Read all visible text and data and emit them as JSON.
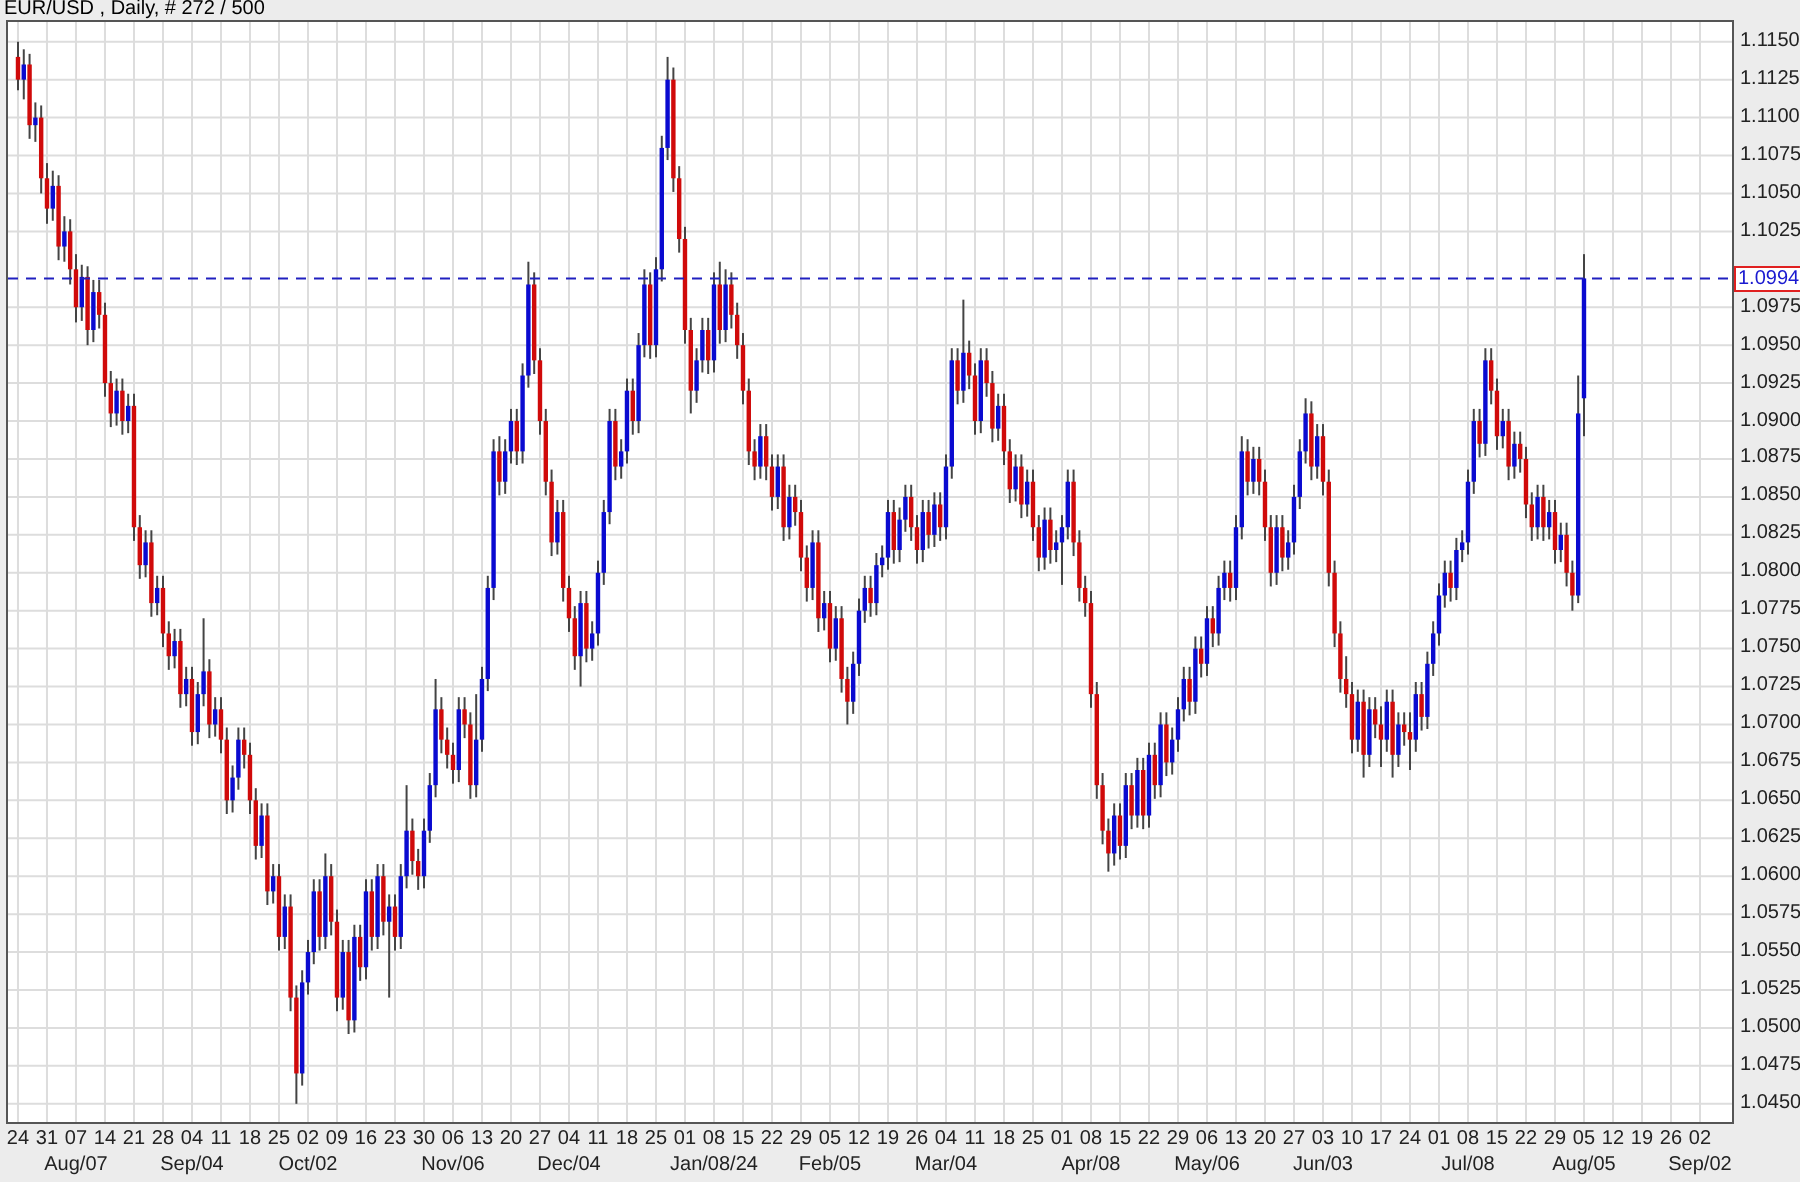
{
  "header": {
    "title": "EUR/USD , Daily, # 272 / 500"
  },
  "chart": {
    "periods": [
      "Aug/07",
      "Sep/04",
      "Oct/02",
      "Nov/06",
      "Dec/04",
      "Jan/08/24",
      "Feb/05",
      "Mar/04",
      "Apr/08",
      "May/06",
      "Jun/03",
      "Jul/08",
      "Aug/05",
      "Sep/02"
    ],
    "chart_data": {
      "type": "candlestick",
      "ylim": [
        1.0438,
        1.1163
      ],
      "grid": true,
      "ref_lines": [
        {
          "axis": "y",
          "value": 1.0994,
          "label": "1.0994"
        }
      ],
      "categories": [
        "24",
        null,
        null,
        null,
        null,
        "31",
        null,
        null,
        null,
        null,
        "07",
        null,
        null,
        null,
        null,
        "14",
        null,
        null,
        null,
        null,
        "21",
        null,
        null,
        null,
        null,
        "28",
        null,
        null,
        null,
        null,
        "04",
        null,
        null,
        null,
        null,
        "11",
        null,
        null,
        null,
        null,
        "18",
        null,
        null,
        null,
        null,
        "25",
        null,
        null,
        null,
        null,
        "02",
        null,
        null,
        null,
        null,
        "09",
        null,
        null,
        null,
        null,
        "16",
        null,
        null,
        null,
        null,
        "23",
        null,
        null,
        null,
        null,
        "30",
        null,
        null,
        null,
        null,
        "06",
        null,
        null,
        null,
        null,
        "13",
        null,
        null,
        null,
        null,
        "20",
        null,
        null,
        null,
        null,
        "27",
        null,
        null,
        null,
        null,
        "04",
        null,
        null,
        null,
        null,
        "11",
        null,
        null,
        null,
        null,
        "18",
        null,
        null,
        null,
        null,
        "25",
        null,
        null,
        null,
        null,
        "01",
        null,
        null,
        null,
        null,
        "08",
        null,
        null,
        null,
        null,
        "15",
        null,
        null,
        null,
        null,
        "22",
        null,
        null,
        null,
        null,
        "29",
        null,
        null,
        null,
        null,
        "05",
        null,
        null,
        null,
        null,
        "12",
        null,
        null,
        null,
        null,
        "19",
        null,
        null,
        null,
        null,
        "26",
        null,
        null,
        null,
        null,
        "04",
        null,
        null,
        null,
        null,
        "11",
        null,
        null,
        null,
        null,
        "18",
        null,
        null,
        null,
        null,
        "25",
        null,
        null,
        null,
        null,
        "01",
        null,
        null,
        null,
        null,
        "08",
        null,
        null,
        null,
        null,
        "15",
        null,
        null,
        null,
        null,
        "22",
        null,
        null,
        null,
        null,
        "29",
        null,
        null,
        null,
        null,
        "06",
        null,
        null,
        null,
        null,
        "13",
        null,
        null,
        null,
        null,
        "20",
        null,
        null,
        null,
        null,
        "27",
        null,
        null,
        null,
        null,
        "03",
        null,
        null,
        null,
        null,
        "10",
        null,
        null,
        null,
        null,
        "17",
        null,
        null,
        null,
        null,
        "24",
        null,
        null,
        null,
        null,
        "01",
        null,
        null,
        null,
        null,
        "08",
        null,
        null,
        null,
        null,
        "15",
        null,
        null,
        null,
        null,
        "22",
        null,
        null,
        null,
        null,
        "29",
        null,
        null,
        null,
        null,
        "05",
        null,
        null,
        null,
        null,
        "12",
        null,
        null,
        null,
        null,
        "19",
        null,
        null,
        null,
        null,
        "26",
        null,
        null,
        null,
        null,
        "02"
      ],
      "yticks": [
        {
          "value": 1.115,
          "label": "1.1150"
        },
        {
          "value": 1.1125,
          "label": "1.1125"
        },
        {
          "value": 1.11,
          "label": "1.1100"
        },
        {
          "value": 1.1075,
          "label": "1.1075"
        },
        {
          "value": 1.105,
          "label": "1.1050"
        },
        {
          "value": 1.1025,
          "label": "1.1025"
        },
        {
          "value": 1.0975,
          "label": "1.0975"
        },
        {
          "value": 1.095,
          "label": "1.0950"
        },
        {
          "value": 1.0925,
          "label": "1.0925"
        },
        {
          "value": 1.09,
          "label": "1.0900"
        },
        {
          "value": 1.0875,
          "label": "1.0875"
        },
        {
          "value": 1.085,
          "label": "1.0850"
        },
        {
          "value": 1.0825,
          "label": "1.0825"
        },
        {
          "value": 1.08,
          "label": "1.0800"
        },
        {
          "value": 1.0775,
          "label": "1.0775"
        },
        {
          "value": 1.075,
          "label": "1.0750"
        },
        {
          "value": 1.0725,
          "label": "1.0725"
        },
        {
          "value": 1.07,
          "label": "1.0700"
        },
        {
          "value": 1.0675,
          "label": "1.0675"
        },
        {
          "value": 1.065,
          "label": "1.0650"
        },
        {
          "value": 1.0625,
          "label": "1.0625"
        },
        {
          "value": 1.06,
          "label": "1.0600"
        },
        {
          "value": 1.0575,
          "label": "1.0575"
        },
        {
          "value": 1.055,
          "label": "1.0550"
        },
        {
          "value": 1.0525,
          "label": "1.0525"
        },
        {
          "value": 1.05,
          "label": "1.0500"
        },
        {
          "value": 1.0475,
          "label": "1.0475"
        },
        {
          "value": 1.045,
          "label": "1.0450"
        }
      ],
      "ohlc": [
        [
          1.114,
          1.115,
          1.1118,
          1.1125
        ],
        [
          1.1125,
          1.1145,
          1.1112,
          1.1135
        ],
        [
          1.1135,
          1.1142,
          1.1086,
          1.1095
        ],
        [
          1.1095,
          1.111,
          1.1084,
          1.11
        ],
        [
          1.11,
          1.1108,
          1.105,
          1.106
        ],
        [
          1.106,
          1.107,
          1.103,
          1.104
        ],
        [
          1.104,
          1.1065,
          1.1032,
          1.1055
        ],
        [
          1.1055,
          1.1062,
          1.1006,
          1.1015
        ],
        [
          1.1015,
          1.1035,
          1.1005,
          1.1025
        ],
        [
          1.1025,
          1.1033,
          1.099,
          1.1
        ],
        [
          1.1,
          1.101,
          1.0965,
          1.0975
        ],
        [
          1.0975,
          1.1003,
          1.0966,
          1.0995
        ],
        [
          1.0995,
          1.1002,
          1.095,
          1.096
        ],
        [
          1.096,
          1.0993,
          1.0952,
          1.0985
        ],
        [
          1.0985,
          1.0993,
          1.0961,
          1.097
        ],
        [
          1.097,
          1.0978,
          1.0916,
          1.0925
        ],
        [
          1.0925,
          1.0933,
          1.0896,
          1.0905
        ],
        [
          1.0905,
          1.0928,
          1.0897,
          1.092
        ],
        [
          1.092,
          1.0928,
          1.0891,
          1.09
        ],
        [
          1.09,
          1.0918,
          1.0892,
          1.091
        ],
        [
          1.091,
          1.0918,
          1.0821,
          1.083
        ],
        [
          1.083,
          1.0838,
          1.0796,
          1.0805
        ],
        [
          1.0805,
          1.0828,
          1.0797,
          1.082
        ],
        [
          1.082,
          1.0828,
          1.0771,
          1.078
        ],
        [
          1.078,
          1.0798,
          1.0772,
          1.079
        ],
        [
          1.079,
          1.0798,
          1.0751,
          1.076
        ],
        [
          1.076,
          1.0768,
          1.0736,
          1.0745
        ],
        [
          1.0745,
          1.0763,
          1.0737,
          1.0755
        ],
        [
          1.0755,
          1.0763,
          1.0711,
          1.072
        ],
        [
          1.072,
          1.0738,
          1.0712,
          1.073
        ],
        [
          1.073,
          1.0738,
          1.0686,
          1.0695
        ],
        [
          1.0695,
          1.0728,
          1.0687,
          1.072
        ],
        [
          1.072,
          1.077,
          1.0712,
          1.0735
        ],
        [
          1.0735,
          1.0743,
          1.0691,
          1.07
        ],
        [
          1.07,
          1.0718,
          1.0692,
          1.071
        ],
        [
          1.071,
          1.0718,
          1.0681,
          1.069
        ],
        [
          1.069,
          1.0698,
          1.0641,
          1.065
        ],
        [
          1.065,
          1.0673,
          1.0642,
          1.0665
        ],
        [
          1.0665,
          1.0698,
          1.0657,
          1.069
        ],
        [
          1.069,
          1.0698,
          1.0671,
          1.068
        ],
        [
          1.068,
          1.0688,
          1.0641,
          1.065
        ],
        [
          1.065,
          1.0658,
          1.0611,
          1.062
        ],
        [
          1.062,
          1.0648,
          1.0612,
          1.064
        ],
        [
          1.064,
          1.0648,
          1.0581,
          1.059
        ],
        [
          1.059,
          1.0608,
          1.0582,
          1.06
        ],
        [
          1.06,
          1.0608,
          1.0551,
          1.056
        ],
        [
          1.056,
          1.0588,
          1.0552,
          1.058
        ],
        [
          1.058,
          1.0588,
          1.0511,
          1.052
        ],
        [
          1.052,
          1.0528,
          1.045,
          1.047
        ],
        [
          1.047,
          1.0538,
          1.0462,
          1.053
        ],
        [
          1.053,
          1.0558,
          1.0522,
          1.055
        ],
        [
          1.055,
          1.0598,
          1.0542,
          1.059
        ],
        [
          1.059,
          1.0598,
          1.0551,
          1.056
        ],
        [
          1.056,
          1.0615,
          1.0552,
          1.06
        ],
        [
          1.06,
          1.0608,
          1.0561,
          1.057
        ],
        [
          1.057,
          1.0578,
          1.0511,
          1.052
        ],
        [
          1.052,
          1.0558,
          1.0512,
          1.055
        ],
        [
          1.055,
          1.0558,
          1.0496,
          1.0505
        ],
        [
          1.0505,
          1.0568,
          1.0497,
          1.056
        ],
        [
          1.056,
          1.0568,
          1.0531,
          1.054
        ],
        [
          1.054,
          1.0598,
          1.0532,
          1.059
        ],
        [
          1.059,
          1.0598,
          1.0551,
          1.056
        ],
        [
          1.056,
          1.0608,
          1.0552,
          1.06
        ],
        [
          1.06,
          1.0608,
          1.0561,
          1.057
        ],
        [
          1.057,
          1.0588,
          1.052,
          1.058
        ],
        [
          1.058,
          1.0588,
          1.0551,
          1.056
        ],
        [
          1.056,
          1.0608,
          1.0552,
          1.06
        ],
        [
          1.06,
          1.066,
          1.0592,
          1.063
        ],
        [
          1.063,
          1.0638,
          1.0601,
          1.061
        ],
        [
          1.061,
          1.0618,
          1.0591,
          1.06
        ],
        [
          1.06,
          1.0638,
          1.0592,
          1.063
        ],
        [
          1.063,
          1.0668,
          1.0622,
          1.066
        ],
        [
          1.066,
          1.073,
          1.0652,
          1.071
        ],
        [
          1.071,
          1.0718,
          1.0681,
          1.069
        ],
        [
          1.069,
          1.0698,
          1.0671,
          1.068
        ],
        [
          1.068,
          1.0688,
          1.0661,
          1.067
        ],
        [
          1.067,
          1.0718,
          1.0662,
          1.071
        ],
        [
          1.071,
          1.0718,
          1.0691,
          1.07
        ],
        [
          1.07,
          1.0708,
          1.0651,
          1.066
        ],
        [
          1.066,
          1.072,
          1.0652,
          1.069
        ],
        [
          1.069,
          1.0738,
          1.0682,
          1.073
        ],
        [
          1.073,
          1.0798,
          1.0722,
          1.079
        ],
        [
          1.079,
          1.0888,
          1.0782,
          1.088
        ],
        [
          1.088,
          1.089,
          1.0851,
          1.086
        ],
        [
          1.086,
          1.0888,
          1.0852,
          1.088
        ],
        [
          1.088,
          1.0908,
          1.0872,
          1.09
        ],
        [
          1.09,
          1.0908,
          1.0871,
          1.088
        ],
        [
          1.088,
          1.0938,
          1.0872,
          1.093
        ],
        [
          1.093,
          1.1005,
          1.0922,
          1.099
        ],
        [
          1.099,
          1.0998,
          1.0931,
          1.094
        ],
        [
          1.094,
          1.0948,
          1.0891,
          1.09
        ],
        [
          1.09,
          1.0908,
          1.0851,
          1.086
        ],
        [
          1.086,
          1.0868,
          1.0811,
          1.082
        ],
        [
          1.082,
          1.0848,
          1.0812,
          1.084
        ],
        [
          1.084,
          1.0848,
          1.0781,
          1.079
        ],
        [
          1.079,
          1.0798,
          1.0761,
          1.077
        ],
        [
          1.077,
          1.0778,
          1.0736,
          1.0745
        ],
        [
          1.0745,
          1.0788,
          1.0725,
          1.078
        ],
        [
          1.078,
          1.0788,
          1.0741,
          1.075
        ],
        [
          1.075,
          1.0768,
          1.0742,
          1.076
        ],
        [
          1.076,
          1.0808,
          1.0752,
          1.08
        ],
        [
          1.08,
          1.0848,
          1.0792,
          1.084
        ],
        [
          1.084,
          1.0908,
          1.0832,
          1.09
        ],
        [
          1.09,
          1.0908,
          1.0861,
          1.087
        ],
        [
          1.087,
          1.0888,
          1.0862,
          1.088
        ],
        [
          1.088,
          1.0928,
          1.0872,
          1.092
        ],
        [
          1.092,
          1.0928,
          1.0891,
          1.09
        ],
        [
          1.09,
          1.0958,
          1.0892,
          1.095
        ],
        [
          1.095,
          1.1,
          1.0942,
          1.099
        ],
        [
          1.099,
          1.0998,
          1.0941,
          1.095
        ],
        [
          1.095,
          1.1008,
          1.0942,
          1.1
        ],
        [
          1.1,
          1.1088,
          1.0992,
          1.108
        ],
        [
          1.108,
          1.114,
          1.1072,
          1.1125
        ],
        [
          1.1125,
          1.1133,
          1.1051,
          1.106
        ],
        [
          1.106,
          1.1068,
          1.1011,
          1.102
        ],
        [
          1.102,
          1.1028,
          1.0951,
          1.096
        ],
        [
          1.096,
          1.0968,
          1.0905,
          1.092
        ],
        [
          1.092,
          1.0948,
          1.0912,
          1.094
        ],
        [
          1.094,
          1.0968,
          1.0932,
          1.096
        ],
        [
          1.096,
          1.0968,
          1.0931,
          1.094
        ],
        [
          1.094,
          1.0998,
          1.0932,
          1.099
        ],
        [
          1.099,
          1.1005,
          1.0951,
          1.096
        ],
        [
          1.096,
          1.1,
          1.0952,
          1.099
        ],
        [
          1.099,
          1.0998,
          1.0961,
          1.097
        ],
        [
          1.097,
          1.0978,
          1.0941,
          1.095
        ],
        [
          1.095,
          1.0958,
          1.0911,
          1.092
        ],
        [
          1.092,
          1.0928,
          1.0871,
          1.088
        ],
        [
          1.088,
          1.0888,
          1.0861,
          1.087
        ],
        [
          1.087,
          1.0898,
          1.0862,
          1.089
        ],
        [
          1.089,
          1.0898,
          1.0861,
          1.087
        ],
        [
          1.087,
          1.0878,
          1.0841,
          1.085
        ],
        [
          1.085,
          1.0878,
          1.0842,
          1.087
        ],
        [
          1.087,
          1.0878,
          1.0821,
          1.083
        ],
        [
          1.083,
          1.0858,
          1.0822,
          1.085
        ],
        [
          1.085,
          1.0858,
          1.0831,
          1.084
        ],
        [
          1.084,
          1.0848,
          1.0801,
          1.081
        ],
        [
          1.081,
          1.0818,
          1.0781,
          1.079
        ],
        [
          1.079,
          1.0828,
          1.0782,
          1.082
        ],
        [
          1.082,
          1.0828,
          1.0761,
          1.077
        ],
        [
          1.077,
          1.0788,
          1.0762,
          1.078
        ],
        [
          1.078,
          1.0788,
          1.0741,
          1.075
        ],
        [
          1.075,
          1.0778,
          1.0742,
          1.077
        ],
        [
          1.077,
          1.0778,
          1.0721,
          1.073
        ],
        [
          1.073,
          1.0738,
          1.07,
          1.0715
        ],
        [
          1.0715,
          1.0748,
          1.0707,
          1.074
        ],
        [
          1.074,
          1.0783,
          1.0732,
          1.0775
        ],
        [
          1.0775,
          1.0798,
          1.0767,
          1.079
        ],
        [
          1.079,
          1.0798,
          1.0771,
          1.078
        ],
        [
          1.078,
          1.0813,
          1.0772,
          1.0805
        ],
        [
          1.0805,
          1.0818,
          1.0797,
          1.081
        ],
        [
          1.081,
          1.0848,
          1.0802,
          1.084
        ],
        [
          1.084,
          1.0848,
          1.0806,
          1.0815
        ],
        [
          1.0815,
          1.0843,
          1.0807,
          1.0835
        ],
        [
          1.0835,
          1.0858,
          1.0827,
          1.085
        ],
        [
          1.085,
          1.0858,
          1.0821,
          1.083
        ],
        [
          1.083,
          1.0838,
          1.0806,
          1.0815
        ],
        [
          1.0815,
          1.0848,
          1.0807,
          1.084
        ],
        [
          1.084,
          1.0848,
          1.0816,
          1.0825
        ],
        [
          1.0825,
          1.0853,
          1.0817,
          1.0845
        ],
        [
          1.0845,
          1.0853,
          1.0821,
          1.083
        ],
        [
          1.083,
          1.0878,
          1.0822,
          1.087
        ],
        [
          1.087,
          1.0948,
          1.0862,
          1.094
        ],
        [
          1.094,
          1.0948,
          1.0911,
          1.092
        ],
        [
          1.092,
          1.098,
          1.0912,
          1.0945
        ],
        [
          1.0945,
          1.0953,
          1.0921,
          1.093
        ],
        [
          1.093,
          1.0938,
          1.0891,
          1.09
        ],
        [
          1.09,
          1.0948,
          1.0892,
          1.094
        ],
        [
          1.094,
          1.0948,
          1.0916,
          1.0925
        ],
        [
          1.0925,
          1.0933,
          1.0886,
          1.0895
        ],
        [
          1.0895,
          1.0918,
          1.0887,
          1.091
        ],
        [
          1.091,
          1.0918,
          1.0871,
          1.088
        ],
        [
          1.088,
          1.0888,
          1.0846,
          1.0855
        ],
        [
          1.0855,
          1.0878,
          1.0847,
          1.087
        ],
        [
          1.087,
          1.0878,
          1.0836,
          1.0845
        ],
        [
          1.0845,
          1.0868,
          1.0837,
          1.086
        ],
        [
          1.086,
          1.0868,
          1.0821,
          1.083
        ],
        [
          1.083,
          1.0838,
          1.0801,
          1.081
        ],
        [
          1.081,
          1.0843,
          1.0802,
          1.0835
        ],
        [
          1.0835,
          1.0843,
          1.0806,
          1.0815
        ],
        [
          1.0815,
          1.0828,
          1.0807,
          1.082
        ],
        [
          1.082,
          1.0838,
          1.0792,
          1.083
        ],
        [
          1.083,
          1.0868,
          1.0822,
          1.086
        ],
        [
          1.086,
          1.0868,
          1.0811,
          1.082
        ],
        [
          1.082,
          1.0828,
          1.0781,
          1.079
        ],
        [
          1.079,
          1.0798,
          1.0771,
          1.078
        ],
        [
          1.078,
          1.0788,
          1.0711,
          1.072
        ],
        [
          1.072,
          1.0728,
          1.0651,
          1.066
        ],
        [
          1.066,
          1.0668,
          1.0621,
          1.063
        ],
        [
          1.063,
          1.0638,
          1.0603,
          1.0615
        ],
        [
          1.0615,
          1.0648,
          1.0607,
          1.064
        ],
        [
          1.064,
          1.0648,
          1.0611,
          1.062
        ],
        [
          1.062,
          1.0668,
          1.0612,
          1.066
        ],
        [
          1.066,
          1.0668,
          1.0631,
          1.064
        ],
        [
          1.064,
          1.0678,
          1.0632,
          1.067
        ],
        [
          1.067,
          1.0678,
          1.0631,
          1.064
        ],
        [
          1.064,
          1.0688,
          1.0632,
          1.068
        ],
        [
          1.068,
          1.0688,
          1.0651,
          1.066
        ],
        [
          1.066,
          1.0708,
          1.0652,
          1.07
        ],
        [
          1.07,
          1.0708,
          1.0666,
          1.0675
        ],
        [
          1.0675,
          1.0698,
          1.0667,
          1.069
        ],
        [
          1.069,
          1.0718,
          1.0682,
          1.071
        ],
        [
          1.071,
          1.0738,
          1.0702,
          1.073
        ],
        [
          1.073,
          1.0738,
          1.0706,
          1.0715
        ],
        [
          1.0715,
          1.0758,
          1.0707,
          1.075
        ],
        [
          1.075,
          1.0758,
          1.0731,
          1.074
        ],
        [
          1.074,
          1.0778,
          1.0732,
          1.077
        ],
        [
          1.077,
          1.0778,
          1.0751,
          1.076
        ],
        [
          1.076,
          1.0798,
          1.0752,
          1.079
        ],
        [
          1.079,
          1.0808,
          1.0782,
          1.08
        ],
        [
          1.08,
          1.0808,
          1.0781,
          1.079
        ],
        [
          1.079,
          1.0838,
          1.0782,
          1.083
        ],
        [
          1.083,
          1.089,
          1.0822,
          1.088
        ],
        [
          1.088,
          1.0888,
          1.0851,
          1.086
        ],
        [
          1.086,
          1.0883,
          1.0852,
          1.0875
        ],
        [
          1.0875,
          1.0883,
          1.0851,
          1.086
        ],
        [
          1.086,
          1.0868,
          1.0821,
          1.083
        ],
        [
          1.083,
          1.0838,
          1.0791,
          1.08
        ],
        [
          1.08,
          1.0838,
          1.0792,
          1.083
        ],
        [
          1.083,
          1.0838,
          1.0801,
          1.081
        ],
        [
          1.081,
          1.0828,
          1.0802,
          1.082
        ],
        [
          1.082,
          1.0858,
          1.0812,
          1.085
        ],
        [
          1.085,
          1.0888,
          1.0842,
          1.088
        ],
        [
          1.088,
          1.0915,
          1.0872,
          1.0905
        ],
        [
          1.0905,
          1.0913,
          1.0861,
          1.087
        ],
        [
          1.087,
          1.0898,
          1.0862,
          1.089
        ],
        [
          1.089,
          1.0898,
          1.0851,
          1.086
        ],
        [
          1.086,
          1.0868,
          1.0791,
          1.08
        ],
        [
          1.08,
          1.0808,
          1.0751,
          1.076
        ],
        [
          1.076,
          1.0768,
          1.0721,
          1.073
        ],
        [
          1.073,
          1.0745,
          1.0711,
          1.072
        ],
        [
          1.072,
          1.0728,
          1.0681,
          1.069
        ],
        [
          1.069,
          1.0723,
          1.0682,
          1.0715
        ],
        [
          1.0715,
          1.0723,
          1.0665,
          1.068
        ],
        [
          1.068,
          1.0718,
          1.0672,
          1.071
        ],
        [
          1.071,
          1.0718,
          1.0691,
          1.07
        ],
        [
          1.07,
          1.0712,
          1.0672,
          1.069
        ],
        [
          1.069,
          1.0723,
          1.0682,
          1.0715
        ],
        [
          1.0715,
          1.0723,
          1.0665,
          1.068
        ],
        [
          1.068,
          1.0708,
          1.0672,
          1.07
        ],
        [
          1.07,
          1.0708,
          1.0686,
          1.0695
        ],
        [
          1.0695,
          1.0708,
          1.067,
          1.069
        ],
        [
          1.069,
          1.0728,
          1.0682,
          1.072
        ],
        [
          1.072,
          1.0728,
          1.0696,
          1.0705
        ],
        [
          1.0705,
          1.0748,
          1.0697,
          1.074
        ],
        [
          1.074,
          1.0768,
          1.0732,
          1.076
        ],
        [
          1.076,
          1.0793,
          1.0752,
          1.0785
        ],
        [
          1.0785,
          1.0808,
          1.0777,
          1.08
        ],
        [
          1.08,
          1.0808,
          1.0781,
          1.079
        ],
        [
          1.079,
          1.0823,
          1.0782,
          1.0815
        ],
        [
          1.0815,
          1.0828,
          1.0807,
          1.082
        ],
        [
          1.082,
          1.0868,
          1.0812,
          1.086
        ],
        [
          1.086,
          1.0908,
          1.0852,
          1.09
        ],
        [
          1.09,
          1.0908,
          1.0876,
          1.0885
        ],
        [
          1.0885,
          1.0948,
          1.0877,
          1.094
        ],
        [
          1.094,
          1.0948,
          1.0911,
          1.092
        ],
        [
          1.092,
          1.0928,
          1.0881,
          1.089
        ],
        [
          1.089,
          1.0908,
          1.0882,
          1.09
        ],
        [
          1.09,
          1.0908,
          1.0861,
          1.087
        ],
        [
          1.087,
          1.0893,
          1.0862,
          1.0885
        ],
        [
          1.0885,
          1.0893,
          1.0866,
          1.0875
        ],
        [
          1.0875,
          1.0883,
          1.0836,
          1.0845
        ],
        [
          1.0845,
          1.0853,
          1.0821,
          1.083
        ],
        [
          1.083,
          1.0858,
          1.0822,
          1.085
        ],
        [
          1.085,
          1.0858,
          1.0821,
          1.083
        ],
        [
          1.083,
          1.0848,
          1.0822,
          1.084
        ],
        [
          1.084,
          1.0848,
          1.0806,
          1.0815
        ],
        [
          1.0815,
          1.0833,
          1.0807,
          1.0825
        ],
        [
          1.0825,
          1.0833,
          1.0791,
          1.08
        ],
        [
          1.08,
          1.0808,
          1.0775,
          1.0785
        ],
        [
          1.0785,
          1.093,
          1.078,
          1.0905
        ],
        [
          1.0915,
          1.101,
          1.089,
          1.0994
        ],
        null,
        null,
        null,
        null,
        null,
        null,
        null,
        null,
        null,
        null,
        null,
        null,
        null,
        null,
        null,
        null,
        null,
        null,
        null,
        null
      ]
    }
  }
}
